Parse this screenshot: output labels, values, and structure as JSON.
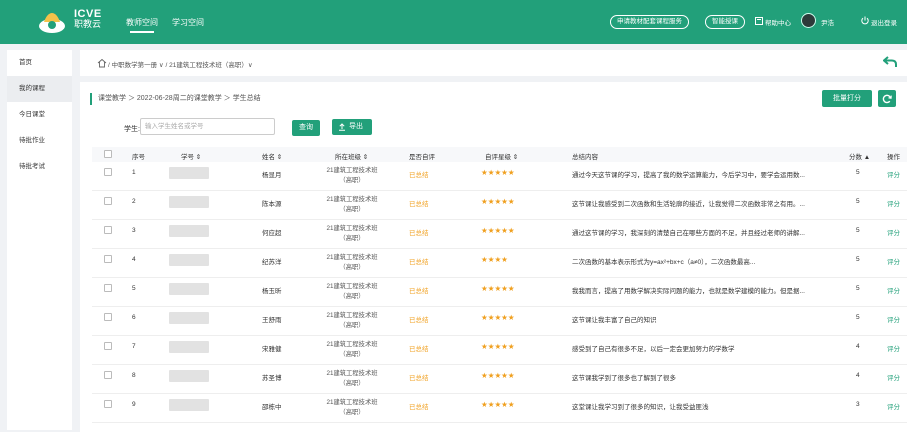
{
  "header": {
    "logo_title": "ICVE",
    "logo_subtitle": "职教云",
    "nav_tabs": [
      {
        "label": "教师空间",
        "active": true
      },
      {
        "label": "学习空间",
        "active": false
      }
    ],
    "right_pills": [
      "申请教材配套课程服务",
      "智能授课"
    ],
    "help_label": "帮助中心",
    "user_name": "尹浩",
    "logout_label": "退出登录"
  },
  "sidebar": {
    "items": [
      {
        "label": "首页",
        "active": false
      },
      {
        "label": "我的课程",
        "active": true
      },
      {
        "label": "今日课堂",
        "active": false
      },
      {
        "label": "待批作业",
        "active": false
      },
      {
        "label": "待批考试",
        "active": false
      }
    ]
  },
  "breadcrumb_top": {
    "text": "/ 中职数学第一册 ∨ / 21建筑工程技术班（高职）∨"
  },
  "breadcrumb_main": {
    "text": "课堂教学 ＞ 2022-06-28周二的课堂教学 ＞ 学生总结"
  },
  "actions": {
    "batch_score": "批量打分",
    "refresh_icon": "refresh-icon"
  },
  "search": {
    "label": "学生:",
    "placeholder": "输入学生姓名或学号",
    "query_button": "查询",
    "export_button": "导出"
  },
  "table": {
    "headers": [
      "序号",
      "学号 ⇕",
      "姓名 ⇕",
      "所在班级 ⇕",
      "是否自评",
      "自评星级 ⇕",
      "总结内容",
      "分数 ▲",
      "操作"
    ],
    "rows": [
      {
        "index": "1",
        "name": "杨显月",
        "class": "21建筑工程技术班（高职）",
        "self_eval": "已总结",
        "stars": "★★★★★",
        "content": "通过今天这节课的学习，提高了我的数学运算能力，今后学习中，要学会运用数...",
        "score": "5",
        "action": "评分"
      },
      {
        "index": "2",
        "name": "陈本源",
        "class": "21建筑工程技术班（高职）",
        "self_eval": "已总结",
        "stars": "★★★★★",
        "content": "这节课让我感受到二次函数和生活轮廓的接近，让我觉得二次函数非常之有用。...",
        "score": "5",
        "action": "评分"
      },
      {
        "index": "3",
        "name": "何应超",
        "class": "21建筑工程技术班（高职）",
        "self_eval": "已总结",
        "stars": "★★★★★",
        "content": "通过这节课的学习，我深刻的清楚自己在哪些方面的不足，并且经过老师的讲解...",
        "score": "5",
        "action": "评分"
      },
      {
        "index": "4",
        "name": "纪苏洋",
        "class": "21建筑工程技术班（高职）",
        "self_eval": "已总结",
        "stars": "★★★★",
        "content": "二次函数的基本表示形式为y=ax²+bx+c（a≠0），二次函数最高...",
        "score": "5",
        "action": "评分"
      },
      {
        "index": "5",
        "name": "杨玉昕",
        "class": "21建筑工程技术班（高职）",
        "self_eval": "已总结",
        "stars": "★★★★★",
        "content": "我我而言，提高了用数学解决实际问题的能力，也就是数学建模的能力。但是据...",
        "score": "5",
        "action": "评分"
      },
      {
        "index": "6",
        "name": "王舒雨",
        "class": "21建筑工程技术班（高职）",
        "self_eval": "已总结",
        "stars": "★★★★★",
        "content": "这节课让我丰富了自己的知识",
        "score": "5",
        "action": "评分"
      },
      {
        "index": "7",
        "name": "宋雅健",
        "class": "21建筑工程技术班（高职）",
        "self_eval": "已总结",
        "stars": "★★★★★",
        "content": "感受到了自己有很多不足，以后一定会更加努力的学数学",
        "score": "4",
        "action": "评分"
      },
      {
        "index": "8",
        "name": "苏圣博",
        "class": "21建筑工程技术班（高职）",
        "self_eval": "已总结",
        "stars": "★★★★★",
        "content": "这节课我学到了很多也了解到了很多",
        "score": "4",
        "action": "评分"
      },
      {
        "index": "9",
        "name": "邵栋中",
        "class": "21建筑工程技术班（高职）",
        "self_eval": "已总结",
        "stars": "★★★★★",
        "content": "这堂课让我学习到了很多的知识，让我受益匪浅",
        "score": "3",
        "action": "评分"
      }
    ]
  },
  "colors": {
    "brand": "#22a07a",
    "star": "#f0a020"
  }
}
